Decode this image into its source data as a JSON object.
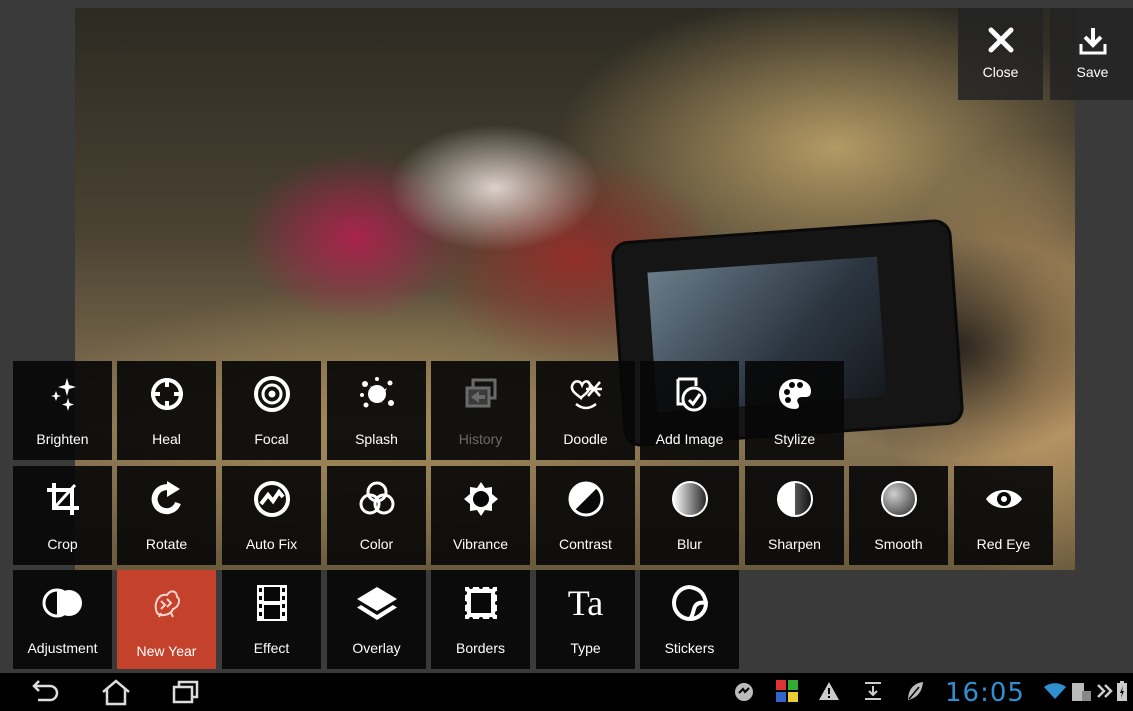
{
  "top_actions": {
    "close_label": "Close",
    "save_label": "Save"
  },
  "tools_row1": [
    {
      "label": "Brighten",
      "icon": "sparkle-icon"
    },
    {
      "label": "Heal",
      "icon": "crosshair-icon"
    },
    {
      "label": "Focal",
      "icon": "target-icon"
    },
    {
      "label": "Splash",
      "icon": "splash-icon"
    },
    {
      "label": "History",
      "icon": "history-icon",
      "disabled": true
    },
    {
      "label": "Doodle",
      "icon": "doodle-icon"
    },
    {
      "label": "Add Image",
      "icon": "add-image-icon"
    },
    {
      "label": "Stylize",
      "icon": "palette-icon"
    }
  ],
  "tools_row2": [
    {
      "label": "Crop",
      "icon": "crop-icon"
    },
    {
      "label": "Rotate",
      "icon": "rotate-icon"
    },
    {
      "label": "Auto Fix",
      "icon": "auto-fix-icon"
    },
    {
      "label": "Color",
      "icon": "color-circles-icon"
    },
    {
      "label": "Vibrance",
      "icon": "vibrance-icon"
    },
    {
      "label": "Contrast",
      "icon": "contrast-icon"
    },
    {
      "label": "Blur",
      "icon": "blur-icon"
    },
    {
      "label": "Sharpen",
      "icon": "sharpen-icon"
    },
    {
      "label": "Smooth",
      "icon": "smooth-icon"
    },
    {
      "label": "Red Eye",
      "icon": "eye-icon"
    }
  ],
  "tools_row3": [
    {
      "label": "Adjustment",
      "icon": "adjustment-icon"
    },
    {
      "label": "New Year",
      "icon": "rooster-icon",
      "active": true
    },
    {
      "label": "Effect",
      "icon": "film-icon"
    },
    {
      "label": "Overlay",
      "icon": "layers-icon"
    },
    {
      "label": "Borders",
      "icon": "borders-icon"
    },
    {
      "label": "Type",
      "icon": "type-icon",
      "glyph": "Ta"
    },
    {
      "label": "Stickers",
      "icon": "sticker-icon"
    }
  ],
  "system_bar": {
    "clock": "16:05"
  },
  "colors": {
    "active_tool": "#c4412c",
    "clock": "#2f8fd0",
    "tile_bg": "#080808"
  }
}
